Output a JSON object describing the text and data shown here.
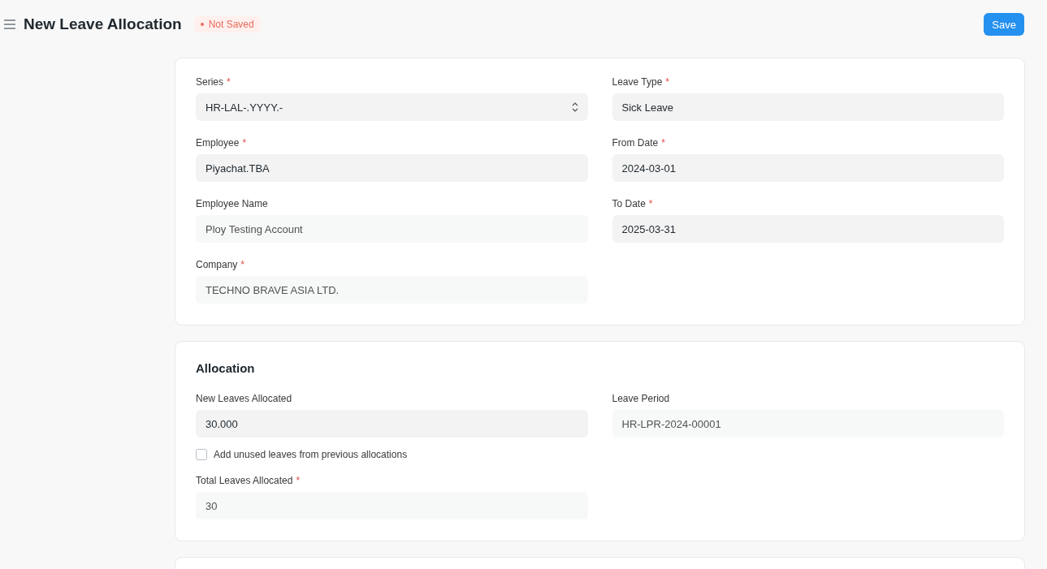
{
  "header": {
    "title": "New Leave Allocation",
    "status": "Not Saved",
    "save": "Save"
  },
  "sections": [
    {
      "columns": [
        [
          {
            "kind": "select",
            "label": "Series",
            "required_mark": "*",
            "value": "HR-LAL-.YYYY.-",
            "read_only": false
          },
          {
            "kind": "input",
            "label": "Employee",
            "required_mark": "*",
            "value": "Piyachat.TBA",
            "read_only": false
          },
          {
            "kind": "input",
            "label": "Employee Name",
            "value": "Ploy Testing Account",
            "read_only": true
          },
          {
            "kind": "input",
            "label": "Company",
            "required_mark": "*",
            "value": "TECHNO BRAVE ASIA LTD.",
            "read_only": true
          }
        ],
        [
          {
            "kind": "input",
            "label": "Leave Type",
            "required_mark": "*",
            "value": "Sick Leave",
            "read_only": false
          },
          {
            "kind": "input",
            "label": "From Date",
            "required_mark": "*",
            "value": "2024-03-01",
            "read_only": false
          },
          {
            "kind": "input",
            "label": "To Date",
            "required_mark": "*",
            "value": "2025-03-31",
            "read_only": false
          }
        ]
      ]
    },
    {
      "title": "Allocation",
      "columns": [
        [
          {
            "kind": "input",
            "label": "New Leaves Allocated",
            "value": "30.000",
            "read_only": false
          },
          {
            "kind": "checkbox",
            "label": "Add unused leaves from previous allocations",
            "checked": false
          },
          {
            "kind": "input",
            "label": "Total Leaves Allocated",
            "required_mark": "*",
            "value": "30",
            "read_only": true
          }
        ],
        [
          {
            "kind": "input",
            "label": "Leave Period",
            "value": "HR-LPR-2024-00001",
            "read_only": true
          }
        ]
      ]
    }
  ],
  "next_section_visible": true
}
